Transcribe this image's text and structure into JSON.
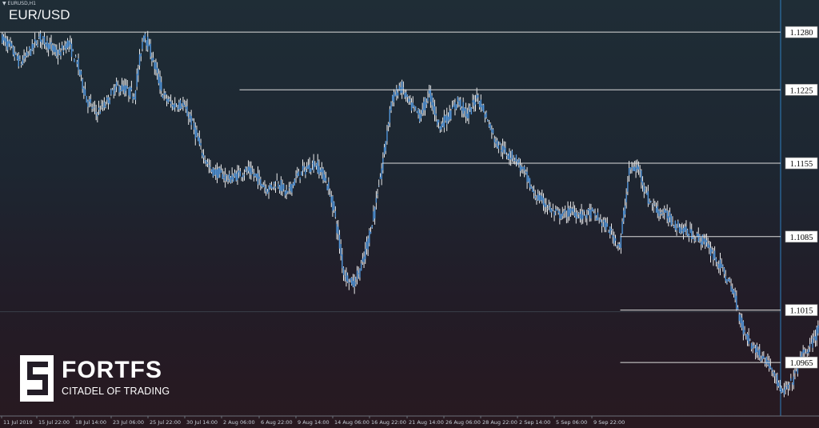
{
  "header": {
    "symbol_timeframe": "EURUSD,H1",
    "symbol": "EUR/USD"
  },
  "brand": {
    "name": "FORTFS",
    "tagline": "CITADEL OF TRADING"
  },
  "colors": {
    "candle": "#4f93d8",
    "wick_up": "#ffffff",
    "levels": "#dcdcdc",
    "price_box_bg": "#ffffff",
    "price_box_text": "#000000",
    "axis_text": "#c8d0d8",
    "vline": "#2f7fc0"
  },
  "chart_data": {
    "type": "line",
    "title": "EUR/USD",
    "timeframe": "H1",
    "ylim": [
      1.0914,
      1.1303
    ],
    "x_ticks": [
      "11 Jul 2019",
      "15 Jul 22:00",
      "18 Jul 14:00",
      "23 Jul 06:00",
      "25 Jul 22:00",
      "30 Jul 14:00",
      "2 Aug 06:00",
      "6 Aug 22:00",
      "9 Aug 14:00",
      "14 Aug 06:00",
      "16 Aug 22:00",
      "21 Aug 14:00",
      "26 Aug 06:00",
      "28 Aug 22:00",
      "2 Sep 14:00",
      "5 Sep 06:00",
      "9 Sep 22:00"
    ],
    "y_ticks": [
      "1.1280",
      "1.1225",
      "1.1155",
      "1.1085",
      "1.1015",
      "1.0965"
    ],
    "levels": [
      {
        "label": "1.1280",
        "value": 1.128,
        "from_index": 0
      },
      {
        "label": "1.1225",
        "value": 1.1225,
        "from_index": 5
      },
      {
        "label": "1.1155",
        "value": 1.1155,
        "from_index": 8
      },
      {
        "label": "1.1085",
        "value": 1.1085,
        "from_index": 13
      },
      {
        "label": "1.1015",
        "value": 1.1015,
        "from_index": 13
      },
      {
        "label": "1.0965",
        "value": 1.0965,
        "from_index": 13
      }
    ],
    "series": [
      {
        "values": [
          [
            0,
            1.1275
          ],
          [
            0.2,
            1.1265
          ],
          [
            0.4,
            1.125
          ],
          [
            0.6,
            1.1262
          ],
          [
            0.8,
            1.1275
          ],
          [
            1.0,
            1.1268
          ],
          [
            1.2,
            1.1258
          ],
          [
            1.4,
            1.127
          ],
          [
            1.6,
            1.125
          ],
          [
            1.8,
            1.1215
          ],
          [
            2.0,
            1.1203
          ],
          [
            2.2,
            1.1212
          ],
          [
            2.4,
            1.1228
          ],
          [
            2.6,
            1.1226
          ],
          [
            2.8,
            1.122
          ],
          [
            3.0,
            1.128
          ],
          [
            3.2,
            1.1252
          ],
          [
            3.4,
            1.122
          ],
          [
            3.6,
            1.121
          ],
          [
            3.8,
            1.1212
          ],
          [
            4.0,
            1.1195
          ],
          [
            4.2,
            1.1168
          ],
          [
            4.4,
            1.1148
          ],
          [
            4.6,
            1.1145
          ],
          [
            4.8,
            1.114
          ],
          [
            5.0,
            1.1145
          ],
          [
            5.2,
            1.1148
          ],
          [
            5.4,
            1.114
          ],
          [
            5.6,
            1.113
          ],
          [
            5.8,
            1.1138
          ],
          [
            6.0,
            1.1125
          ],
          [
            6.2,
            1.1142
          ],
          [
            6.4,
            1.115
          ],
          [
            6.6,
            1.1155
          ],
          [
            6.8,
            1.1142
          ],
          [
            7.0,
            1.111
          ],
          [
            7.2,
            1.105
          ],
          [
            7.4,
            1.104
          ],
          [
            7.6,
            1.106
          ],
          [
            7.8,
            1.11
          ],
          [
            8.0,
            1.115
          ],
          [
            8.2,
            1.1215
          ],
          [
            8.4,
            1.1228
          ],
          [
            8.6,
            1.121
          ],
          [
            8.8,
            1.12
          ],
          [
            9.0,
            1.1222
          ],
          [
            9.2,
            1.119
          ],
          [
            9.4,
            1.12
          ],
          [
            9.6,
            1.1215
          ],
          [
            9.8,
            1.12
          ],
          [
            10.0,
            1.122
          ],
          [
            10.2,
            1.1198
          ],
          [
            10.4,
            1.1175
          ],
          [
            10.6,
            1.1165
          ],
          [
            10.8,
            1.116
          ],
          [
            11.0,
            1.1145
          ],
          [
            11.2,
            1.1125
          ],
          [
            11.4,
            1.1118
          ],
          [
            11.6,
            1.1108
          ],
          [
            11.8,
            1.1105
          ],
          [
            12.0,
            1.111
          ],
          [
            12.2,
            1.1105
          ],
          [
            12.4,
            1.1108
          ],
          [
            12.6,
            1.11
          ],
          [
            12.8,
            1.109
          ],
          [
            13.0,
            1.1075
          ],
          [
            13.2,
            1.115
          ],
          [
            13.4,
            1.115
          ],
          [
            13.6,
            1.112
          ],
          [
            13.8,
            1.111
          ],
          [
            14.0,
            1.1105
          ],
          [
            14.2,
            1.1095
          ],
          [
            14.4,
            1.109
          ],
          [
            14.6,
            1.1085
          ],
          [
            14.8,
            1.108
          ],
          [
            15.0,
            1.1065
          ],
          [
            15.2,
            1.105
          ],
          [
            15.4,
            1.103
          ],
          [
            15.6,
            1.0995
          ],
          [
            15.8,
            1.098
          ],
          [
            16.0,
            1.097
          ],
          [
            16.2,
            1.096
          ],
          [
            16.4,
            1.0935
          ],
          [
            16.6,
            1.0945
          ],
          [
            16.8,
            1.097
          ],
          [
            17.0,
            1.098
          ],
          [
            17.2,
            1.1
          ],
          [
            17.4,
            1.102
          ],
          [
            17.6,
            1.1025
          ],
          [
            17.8,
            1.103
          ],
          [
            18.0,
            1.1065
          ],
          [
            18.2,
            1.104
          ],
          [
            18.4,
            1.103
          ],
          [
            18.6,
            1.102
          ],
          [
            18.8,
            1.103
          ],
          [
            19.0,
            1.1035
          ],
          [
            19.2,
            1.1055
          ],
          [
            19.4,
            1.105
          ],
          [
            19.6,
            1.104
          ],
          [
            19.8,
            1.1045
          ],
          [
            20.0,
            1.104
          ],
          [
            20.2,
            1.101
          ],
          [
            20.4,
            1.0995
          ],
          [
            20.6,
            1.1005
          ],
          [
            20.8,
            1.101
          ],
          [
            21.0,
            1.1015
          ]
        ]
      }
    ]
  }
}
